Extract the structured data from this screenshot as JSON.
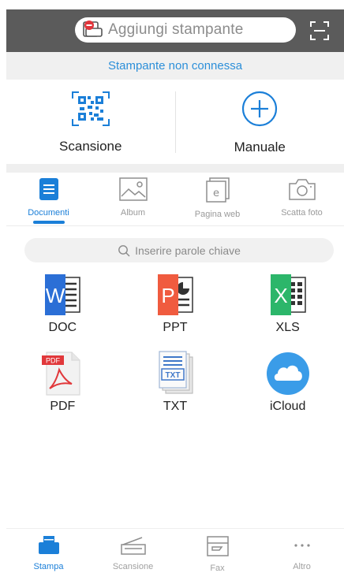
{
  "header": {
    "add_printer_label": "Aggiungi stampante"
  },
  "status": {
    "text": "Stampante non connessa",
    "color": "#2c8fd9"
  },
  "actions": [
    {
      "label": "Scansione",
      "icon": "qr-code-icon"
    },
    {
      "label": "Manuale",
      "icon": "plus-circle-icon"
    }
  ],
  "tabs": [
    {
      "label": "Documenti",
      "icon": "document-icon",
      "active": true
    },
    {
      "label": "Album",
      "icon": "image-icon",
      "active": false
    },
    {
      "label": "Pagina web",
      "icon": "web-page-icon",
      "active": false
    },
    {
      "label": "Scatta foto",
      "icon": "camera-icon",
      "active": false
    }
  ],
  "search": {
    "placeholder": "Inserire parole chiave"
  },
  "files": [
    {
      "label": "DOC",
      "icon": "word-icon",
      "color": "#2b6fd6"
    },
    {
      "label": "PPT",
      "icon": "powerpoint-icon",
      "color": "#f05b3f"
    },
    {
      "label": "XLS",
      "icon": "excel-icon",
      "color": "#2cb66a"
    },
    {
      "label": "PDF",
      "icon": "pdf-icon",
      "color": "#e1383b"
    },
    {
      "label": "TXT",
      "icon": "txt-icon",
      "color": "#3f78c9"
    },
    {
      "label": "iCloud",
      "icon": "icloud-icon",
      "color": "#3a9ce8"
    }
  ],
  "bottom_nav": [
    {
      "label": "Stampa",
      "icon": "printer-icon",
      "active": true
    },
    {
      "label": "Scansione",
      "icon": "scanner-icon",
      "active": false
    },
    {
      "label": "Fax",
      "icon": "fax-icon",
      "active": false
    },
    {
      "label": "Altro",
      "icon": "more-icon",
      "active": false
    }
  ],
  "accent_color": "#1b7fd8"
}
